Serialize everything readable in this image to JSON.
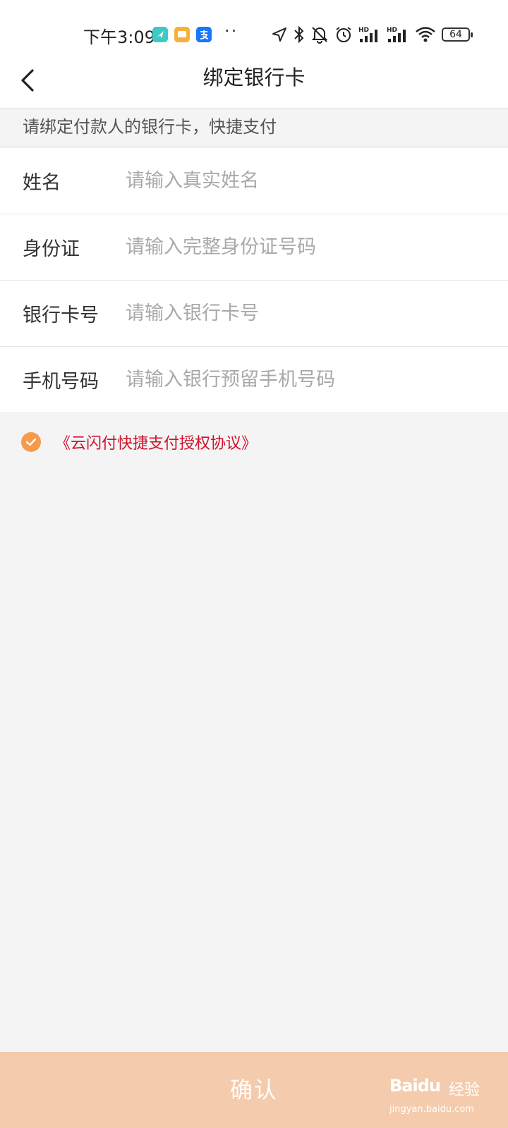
{
  "status_bar": {
    "time": "下午3:09",
    "battery": "64",
    "app_icons": [
      {
        "name": "navigation-app-icon",
        "color": "#3ec9c4"
      },
      {
        "name": "chat-app-icon",
        "color": "#f6b13b"
      },
      {
        "name": "alipay-app-icon",
        "color": "#1677ff"
      }
    ],
    "more": "··",
    "signal_labels": [
      "HD",
      "HD"
    ]
  },
  "nav": {
    "title": "绑定银行卡",
    "back_icon": "chevron-left-icon"
  },
  "hint": "请绑定付款人的银行卡，快捷支付",
  "form": {
    "fields": [
      {
        "label": "姓名",
        "placeholder": "请输入真实姓名",
        "value": ""
      },
      {
        "label": "身份证",
        "placeholder": "请输入完整身份证号码",
        "value": ""
      },
      {
        "label": "银行卡号",
        "placeholder": "请输入银行卡号",
        "value": ""
      },
      {
        "label": "手机号码",
        "placeholder": "请输入银行预留手机号码",
        "value": ""
      }
    ]
  },
  "agreement": {
    "checked": true,
    "link_text": "《云闪付快捷支付授权协议》"
  },
  "confirm": {
    "label": "确认"
  },
  "watermark": {
    "brand": "Baidu",
    "suffix": "经验",
    "url": "jingyan.baidu.com"
  },
  "colors": {
    "accent": "#f79a4b",
    "link": "#d0122b",
    "confirm_bg": "#f4cbac",
    "page_bg": "#f4f4f4"
  }
}
